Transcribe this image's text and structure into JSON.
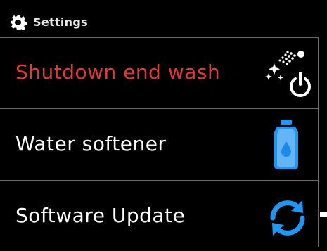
{
  "header": {
    "title": "Settings",
    "icon": "gear-icon"
  },
  "menu": {
    "items": [
      {
        "label": "Shutdown end wash",
        "color": "#e53935",
        "icon": "spray-power-icon",
        "selected": true
      },
      {
        "label": "Water softener",
        "color": "#ffffff",
        "icon": "water-bottle-icon"
      },
      {
        "label": "Software Update",
        "color": "#ffffff",
        "icon": "sync-icon"
      }
    ]
  },
  "colors": {
    "accent_red": "#e53935",
    "icon_blue": "#2196f3",
    "divider": "#6a6a6a"
  }
}
